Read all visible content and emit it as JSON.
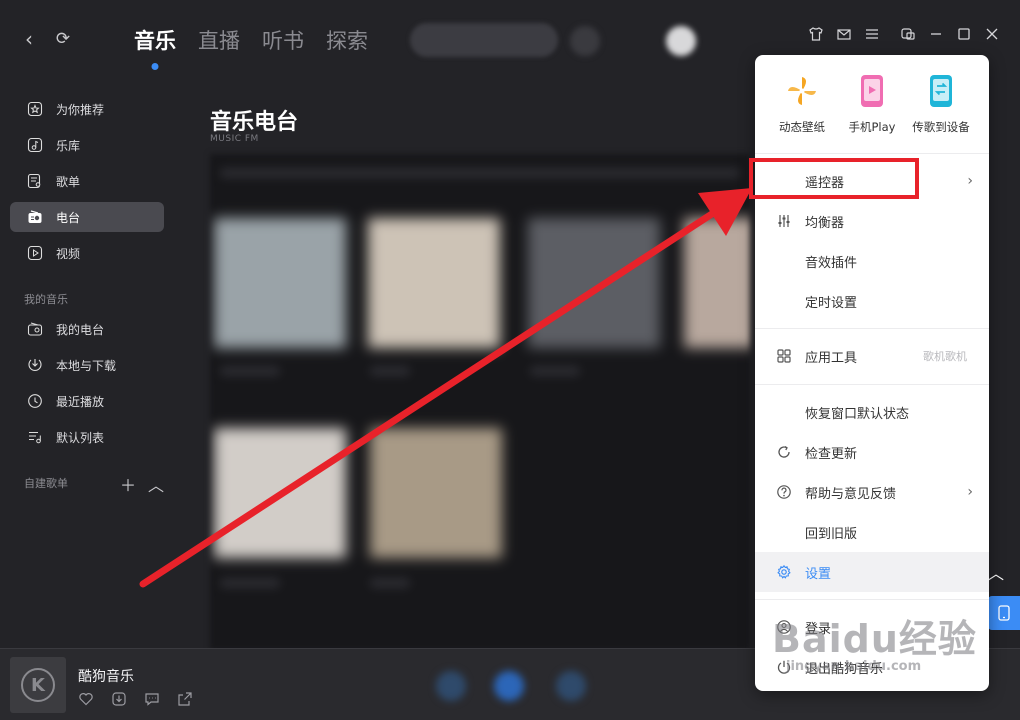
{
  "nav": {
    "back": "‹",
    "refresh": "⟳"
  },
  "tabs": [
    "音乐",
    "直播",
    "听书",
    "探索"
  ],
  "sidebar": {
    "items": [
      {
        "label": "为你推荐",
        "icon": "star-icon"
      },
      {
        "label": "乐库",
        "icon": "music-note-icon"
      },
      {
        "label": "歌单",
        "icon": "playlist-icon"
      },
      {
        "label": "电台",
        "icon": "radio-icon"
      },
      {
        "label": "视频",
        "icon": "video-icon"
      }
    ],
    "my_music_title": "我的音乐",
    "my_items": [
      {
        "label": "我的电台",
        "icon": "radio-icon"
      },
      {
        "label": "本地与下载",
        "icon": "download-icon"
      },
      {
        "label": "最近播放",
        "icon": "clock-icon"
      },
      {
        "label": "默认列表",
        "icon": "list-icon"
      }
    ],
    "custom_title": "自建歌单"
  },
  "main": {
    "title": "音乐电台",
    "subtitle": "MUSIC FM"
  },
  "menu": {
    "quick": [
      {
        "label": "动态壁纸",
        "icon": "pinwheel-icon"
      },
      {
        "label": "手机Play",
        "icon": "phone-play-icon"
      },
      {
        "label": "传歌到设备",
        "icon": "transfer-device-icon"
      }
    ],
    "items": [
      {
        "label": "遥控器",
        "arrow": "›"
      },
      {
        "label": "均衡器",
        "icon": "equalizer-icon"
      },
      {
        "label": "音效插件"
      },
      {
        "label": "定时设置"
      },
      {
        "label": "应用工具",
        "icon": "grid-icon",
        "hint": "歌机歌机"
      },
      {
        "label": "恢复窗口默认状态"
      },
      {
        "label": "检查更新",
        "icon": "refresh-icon"
      },
      {
        "label": "帮助与意见反馈",
        "icon": "help-icon",
        "arrow": "›"
      },
      {
        "label": "回到旧版"
      },
      {
        "label": "设置",
        "icon": "gear-icon"
      },
      {
        "label": "登录",
        "icon": "user-icon"
      },
      {
        "label": "退出酷狗音乐",
        "icon": "power-icon"
      }
    ]
  },
  "player": {
    "title": "酷狗音乐",
    "logo": "K"
  },
  "watermark": {
    "main": "Baidu经验",
    "sub": "jingyan.baidu.com"
  },
  "colors": {
    "accent": "#3b8cf5",
    "annotation": "#e8222a"
  }
}
